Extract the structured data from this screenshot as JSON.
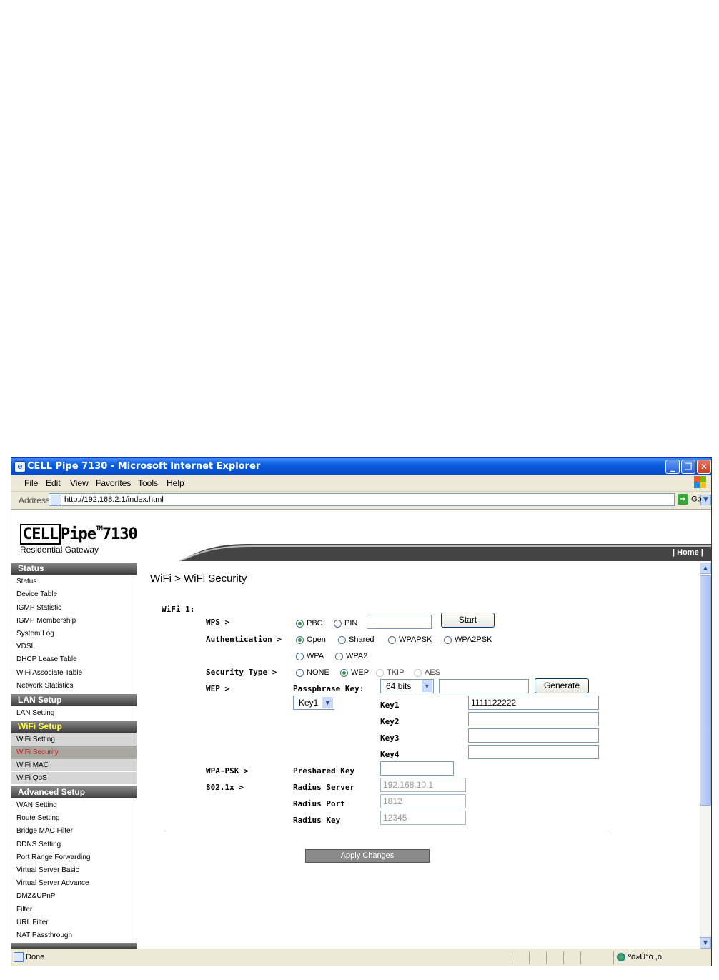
{
  "window": {
    "title": "CELL Pipe 7130 - Microsoft Internet Explorer"
  },
  "menu": [
    "File",
    "Edit",
    "View",
    "Favorites",
    "Tools",
    "Help"
  ],
  "address": {
    "label": "Address",
    "url": "http://192.168.2.1/index.html",
    "go": "Go"
  },
  "logo": {
    "brand_box": "CELL",
    "brand_rest": "Pipe",
    "tm": "TM",
    "model": "7130",
    "subtitle": "Residential Gateway"
  },
  "header": {
    "home": "| Home |"
  },
  "sidebar": {
    "status": {
      "title": "Status",
      "items": [
        "Status",
        "Device Table",
        "IGMP Statistic",
        "IGMP Membership",
        "System Log",
        "VDSL",
        "DHCP Lease Table",
        "WiFi Associate Table",
        "Network Statistics"
      ]
    },
    "lan": {
      "title": "LAN Setup",
      "items": [
        "LAN Setting"
      ]
    },
    "wifi": {
      "title": "WiFi Setup",
      "items": [
        "WiFi Setting",
        "WiFi Security",
        "WiFi MAC",
        "WiFi QoS"
      ]
    },
    "advanced": {
      "title": "Advanced Setup",
      "items": [
        "WAN Setting",
        "Route Setting",
        "Bridge MAC Filter",
        "DDNS Setting",
        "Port Range Forwarding",
        "Virtual Server Basic",
        "Virtual Server Advance",
        "DMZ&UPnP",
        "Filter",
        "URL Filter",
        "NAT Passthrough"
      ]
    },
    "selected": "WiFi Security"
  },
  "main": {
    "title": "WiFi > WiFi Security",
    "wifi_label": "WiFi 1:",
    "wps": {
      "label": "WPS >",
      "pbc": "PBC",
      "pin": "PIN",
      "selected": "PBC",
      "pin_value": "",
      "start": "Start"
    },
    "auth": {
      "label": "Authentication >",
      "options": [
        "Open",
        "Shared",
        "WPAPSK",
        "WPA2PSK",
        "WPA",
        "WPA2"
      ],
      "selected": "Open"
    },
    "security_type": {
      "label": "Security Type >",
      "options": [
        "NONE",
        "WEP",
        "TKIP",
        "AES"
      ],
      "selected": "WEP"
    },
    "wep": {
      "label": "WEP >",
      "passphrase_label": "Passphrase Key:",
      "bits": "64 bits",
      "passphrase": "",
      "generate": "Generate",
      "key_select": "Key1",
      "keys": [
        {
          "label": "Key1",
          "value": "1111122222"
        },
        {
          "label": "Key2",
          "value": ""
        },
        {
          "label": "Key3",
          "value": ""
        },
        {
          "label": "Key4",
          "value": ""
        }
      ]
    },
    "wpa_psk": {
      "label": "WPA-PSK >",
      "preshared_label": "Preshared Key",
      "preshared": ""
    },
    "dot1x": {
      "label": "802.1x >",
      "server_label": "Radius Server",
      "server": "192.168.10.1",
      "port_label": "Radius Port",
      "port": "1812",
      "key_label": "Radius Key",
      "key": "12345"
    },
    "apply": "Apply Changes"
  },
  "statusbar": {
    "text": "Done",
    "zone": "ºõ»Ú°ó ,ó"
  }
}
